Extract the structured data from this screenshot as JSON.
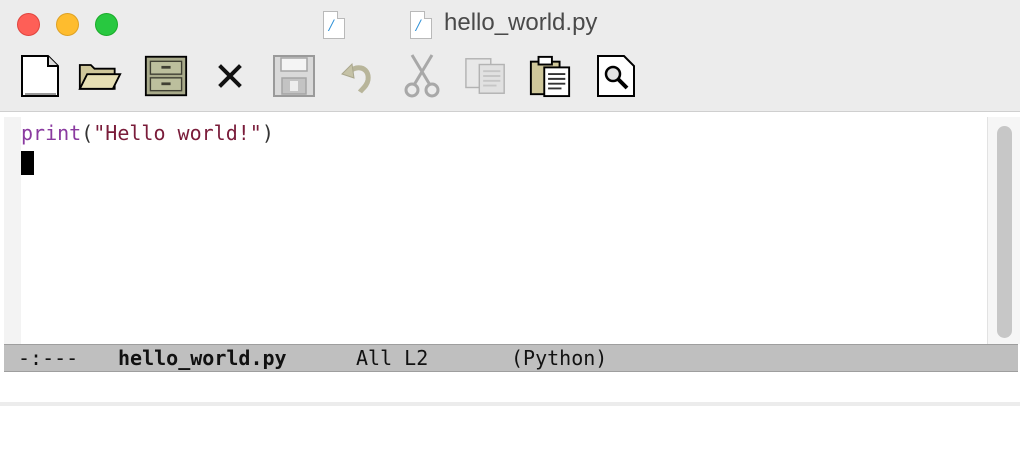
{
  "window": {
    "title": "hello_world.py",
    "proxy_icon_glyph": "/"
  },
  "toolbar": {
    "buttons": [
      {
        "name": "new-file",
        "icon": "new-file-icon",
        "enabled": true
      },
      {
        "name": "open-file",
        "icon": "open-folder-icon",
        "enabled": true
      },
      {
        "name": "open-directory",
        "icon": "file-cabinet-icon",
        "enabled": true
      },
      {
        "name": "close",
        "icon": "close-x-icon",
        "enabled": true
      },
      {
        "name": "save",
        "icon": "floppy-disk-icon",
        "enabled": false
      },
      {
        "name": "undo",
        "icon": "undo-arrow-icon",
        "enabled": false
      },
      {
        "name": "cut",
        "icon": "scissors-icon",
        "enabled": false
      },
      {
        "name": "copy",
        "icon": "copy-icon",
        "enabled": false
      },
      {
        "name": "paste",
        "icon": "clipboard-icon",
        "enabled": true
      },
      {
        "name": "search",
        "icon": "magnifier-icon",
        "enabled": true
      }
    ]
  },
  "editor": {
    "line1": {
      "keyword": "print",
      "open_paren": "(",
      "string": "\"Hello world!\"",
      "close_paren": ")"
    }
  },
  "modeline": {
    "status": "-:---",
    "buffer_name": "hello_world.py",
    "position": "All L2",
    "mode": "(Python)"
  },
  "colors": {
    "keyword": "#8a3aa0",
    "string": "#7a1c3a",
    "modeline_bg": "#bfbfbf",
    "titlebar_bg": "#ececec"
  }
}
